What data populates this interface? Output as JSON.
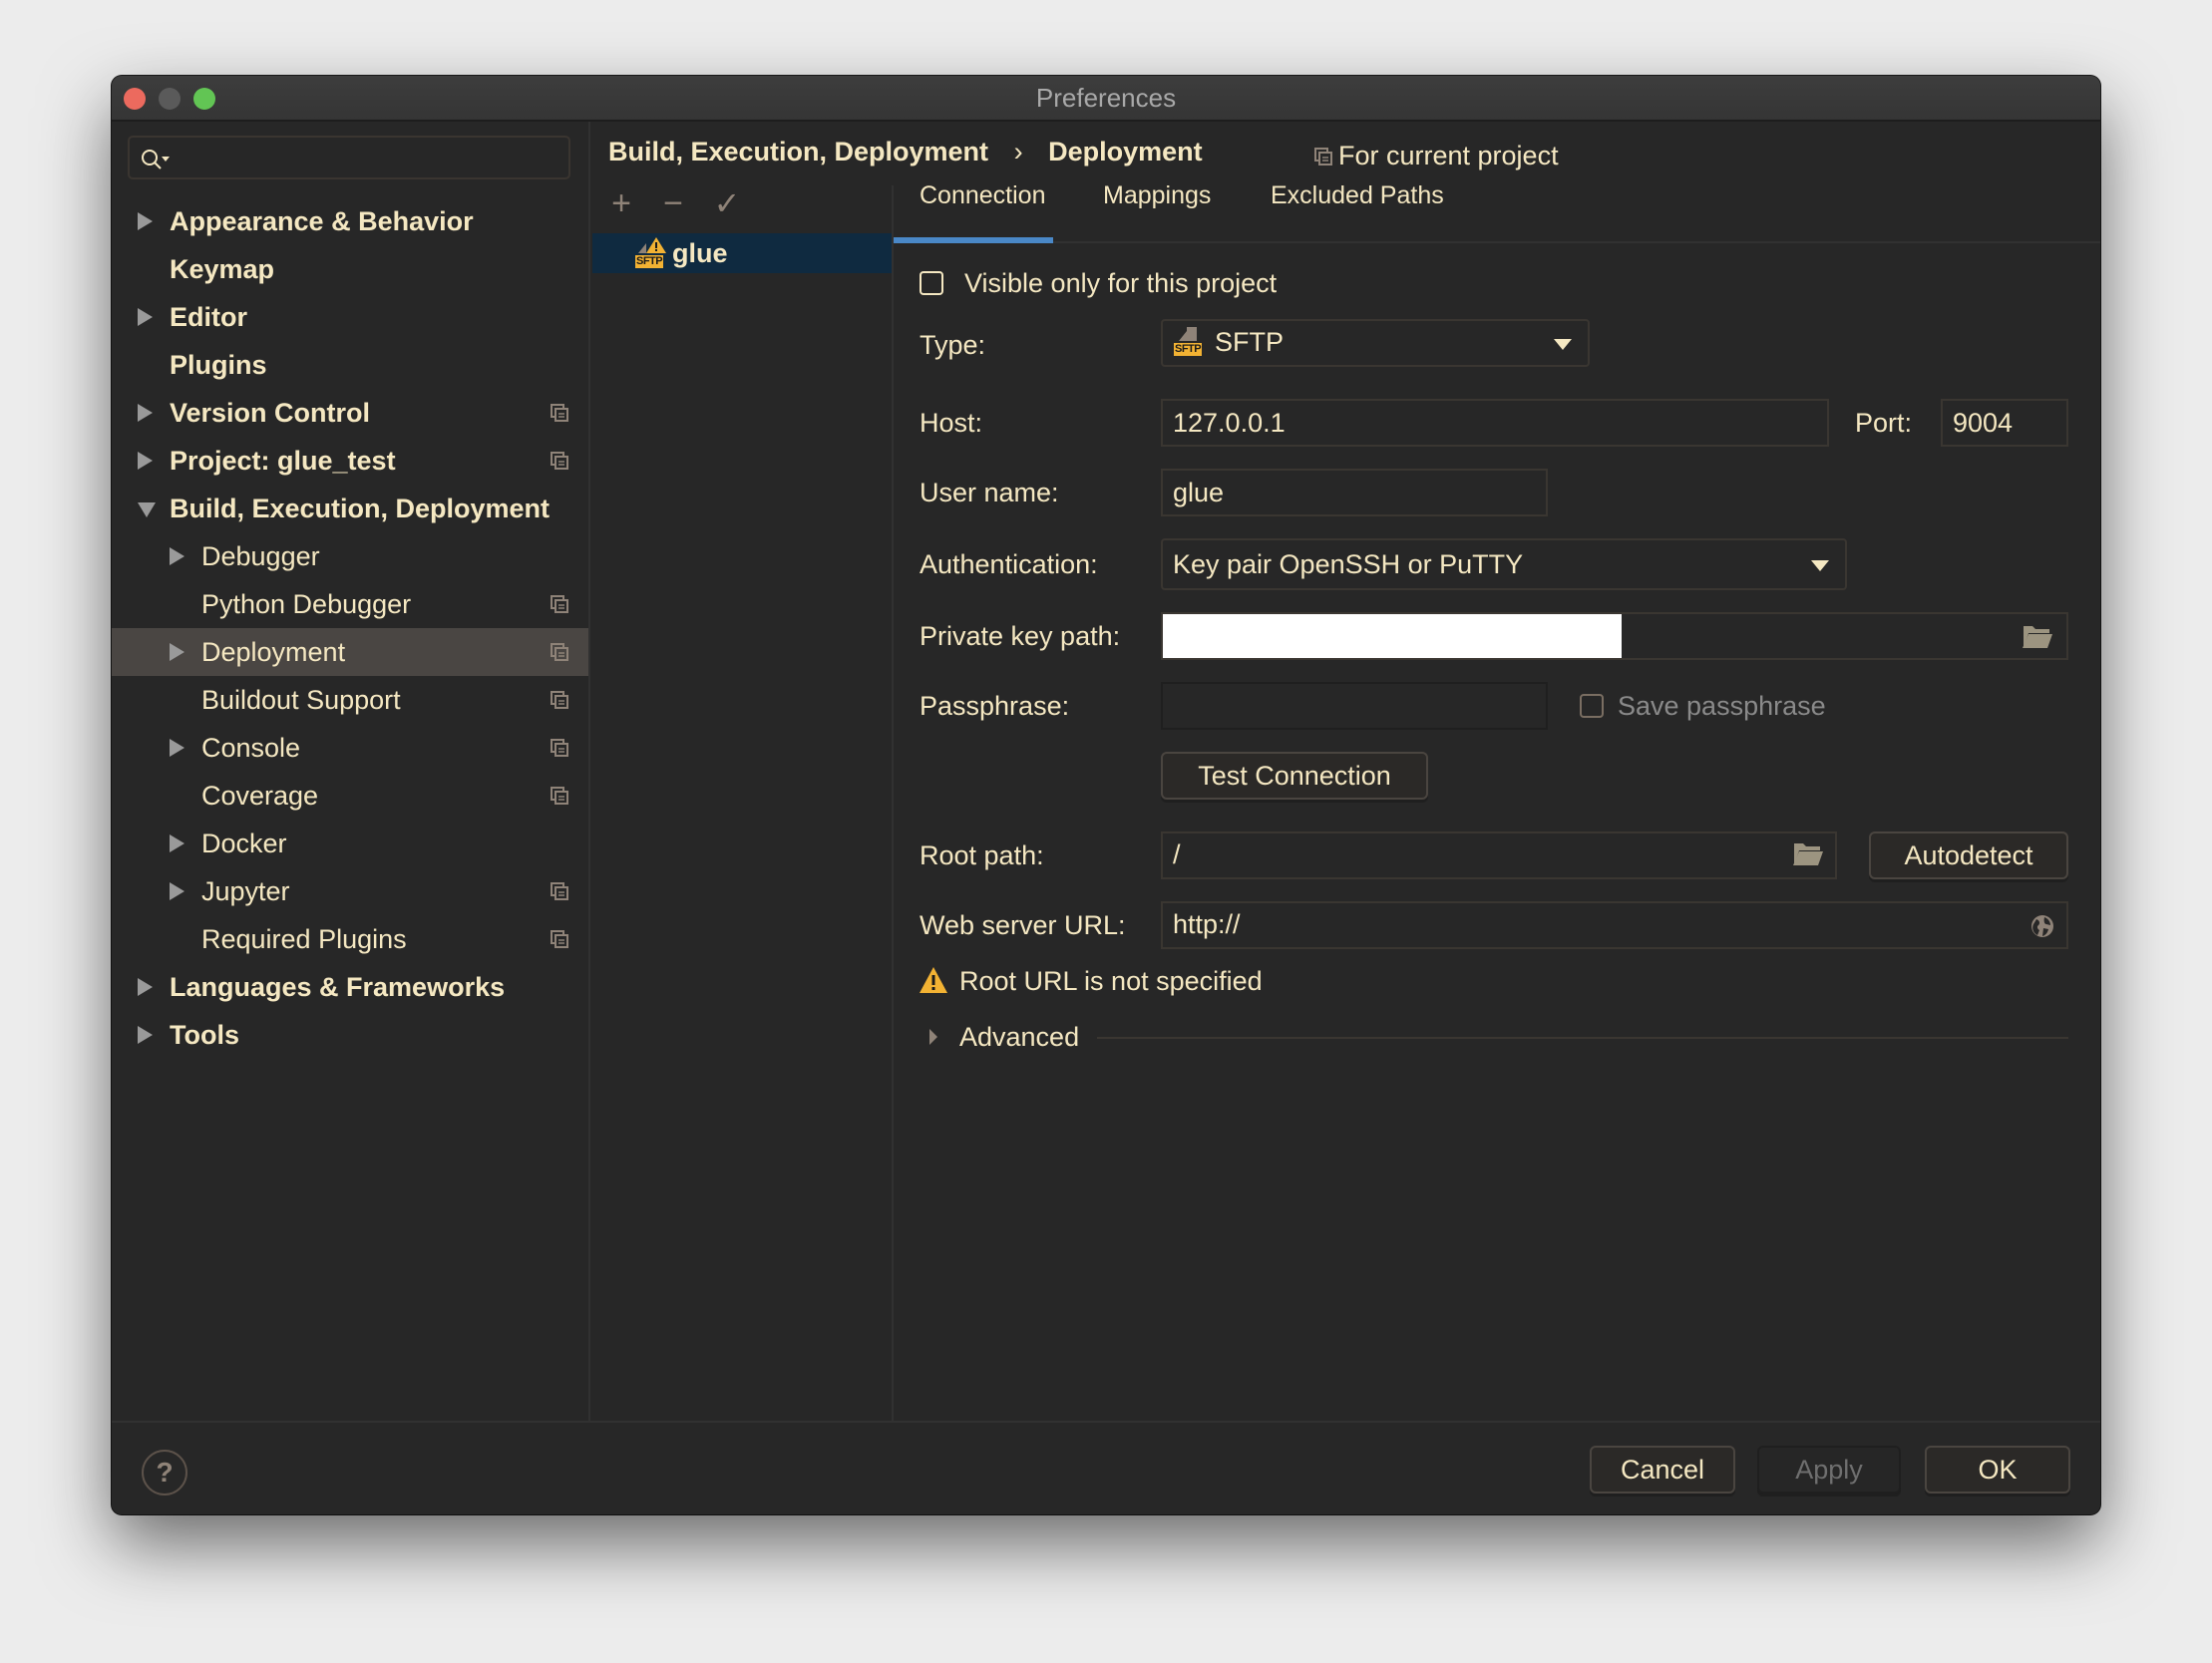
{
  "window": {
    "title": "Preferences",
    "traffic_lights": {
      "close": "#ec6a5e",
      "minimize": "#5a5a5a",
      "zoom": "#62c554"
    }
  },
  "sidebar": {
    "search": {
      "icon": "search-icon",
      "placeholder": ""
    },
    "items": [
      {
        "label": "Appearance & Behavior",
        "level": 0,
        "expandable": true,
        "expanded": false,
        "bold": true,
        "project_scoped": false
      },
      {
        "label": "Keymap",
        "level": 0,
        "expandable": false,
        "bold": true,
        "project_scoped": false
      },
      {
        "label": "Editor",
        "level": 0,
        "expandable": true,
        "expanded": false,
        "bold": true,
        "project_scoped": false
      },
      {
        "label": "Plugins",
        "level": 0,
        "expandable": false,
        "bold": true,
        "project_scoped": false
      },
      {
        "label": "Version Control",
        "level": 0,
        "expandable": true,
        "expanded": false,
        "bold": true,
        "project_scoped": true
      },
      {
        "label": "Project: glue_test",
        "level": 0,
        "expandable": true,
        "expanded": false,
        "bold": true,
        "project_scoped": true
      },
      {
        "label": "Build, Execution, Deployment",
        "level": 0,
        "expandable": true,
        "expanded": true,
        "bold": true,
        "project_scoped": false
      },
      {
        "label": "Debugger",
        "level": 1,
        "expandable": true,
        "expanded": false,
        "bold": false,
        "project_scoped": false
      },
      {
        "label": "Python Debugger",
        "level": 1,
        "expandable": false,
        "bold": false,
        "project_scoped": true
      },
      {
        "label": "Deployment",
        "level": 1,
        "expandable": true,
        "expanded": false,
        "bold": false,
        "project_scoped": true,
        "selected": true
      },
      {
        "label": "Buildout Support",
        "level": 1,
        "expandable": false,
        "bold": false,
        "project_scoped": true
      },
      {
        "label": "Console",
        "level": 1,
        "expandable": true,
        "expanded": false,
        "bold": false,
        "project_scoped": true
      },
      {
        "label": "Coverage",
        "level": 1,
        "expandable": false,
        "bold": false,
        "project_scoped": true
      },
      {
        "label": "Docker",
        "level": 1,
        "expandable": true,
        "expanded": false,
        "bold": false,
        "project_scoped": false
      },
      {
        "label": "Jupyter",
        "level": 1,
        "expandable": true,
        "expanded": false,
        "bold": false,
        "project_scoped": true
      },
      {
        "label": "Required Plugins",
        "level": 1,
        "expandable": false,
        "bold": false,
        "project_scoped": true
      },
      {
        "label": "Languages & Frameworks",
        "level": 0,
        "expandable": true,
        "expanded": false,
        "bold": true,
        "project_scoped": false
      },
      {
        "label": "Tools",
        "level": 0,
        "expandable": true,
        "expanded": false,
        "bold": true,
        "project_scoped": false
      }
    ]
  },
  "header": {
    "breadcrumb": [
      "Build, Execution, Deployment",
      "Deployment"
    ],
    "breadcrumb_separator": "›",
    "scope_label": "For current project"
  },
  "servers": {
    "toolbar": {
      "add": "+",
      "remove": "−",
      "set_default": "✓"
    },
    "items": [
      {
        "name": "glue",
        "type_badge": "SFTP",
        "warning": true,
        "selected": true
      }
    ]
  },
  "tabs": [
    {
      "label": "Connection",
      "active": true
    },
    {
      "label": "Mappings",
      "active": false
    },
    {
      "label": "Excluded Paths",
      "active": false
    }
  ],
  "connection": {
    "visible_only_label": "Visible only for this project",
    "visible_only_checked": false,
    "type_label": "Type:",
    "type_value": "SFTP",
    "type_badge": "SFTP",
    "host_label": "Host:",
    "host_value": "127.0.0.1",
    "port_label": "Port:",
    "port_value": "9004",
    "username_label": "User name:",
    "username_value": "glue",
    "auth_label": "Authentication:",
    "auth_value": "Key pair OpenSSH or PuTTY",
    "private_key_label": "Private key path:",
    "private_key_value": "",
    "passphrase_label": "Passphrase:",
    "passphrase_value": "",
    "save_passphrase_label": "Save passphrase",
    "save_passphrase_checked": false,
    "test_connection_label": "Test Connection",
    "root_path_label": "Root path:",
    "root_path_value": "/",
    "autodetect_label": "Autodetect",
    "web_url_label": "Web server URL:",
    "web_url_value": "http://",
    "warning_text": "Root URL is not specified",
    "advanced_label": "Advanced"
  },
  "footer": {
    "help": "?",
    "cancel_label": "Cancel",
    "apply_label": "Apply",
    "apply_enabled": false,
    "ok_label": "OK"
  },
  "colors": {
    "text": "#f5e8c2",
    "background": "#272727",
    "accent_tab": "#4a88c7",
    "selection_list": "#0f2a40",
    "selection_tree": "#4a4643",
    "warning": "#f2b233"
  }
}
